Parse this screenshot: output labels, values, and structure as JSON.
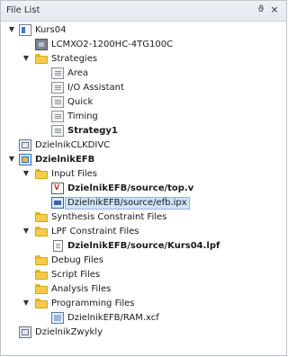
{
  "panel": {
    "title": "File List",
    "pin_glyph": "ϑ",
    "close_glyph": "×"
  },
  "tree": {
    "project": "Kurs04",
    "device": "LCMXO2-1200HC-4TG100C",
    "strategies_folder": "Strategies",
    "strategies": [
      "Area",
      "I/O Assistant",
      "Quick",
      "Timing",
      "Strategy1"
    ],
    "impl1": "DzielnikCLKDIVC",
    "impl2": "DzielnikEFB",
    "input_files_folder": "Input Files",
    "input_files": [
      "DzielnikEFB/source/top.v",
      "DzielnikEFB/source/efb.ipx"
    ],
    "synthesis_folder": "Synthesis Constraint Files",
    "lpf_folder": "LPF Constraint Files",
    "lpf_file": "DzielnikEFB/source/Kurs04.lpf",
    "debug_folder": "Debug Files",
    "script_folder": "Script Files",
    "analysis_folder": "Analysis Files",
    "programming_folder": "Programming Files",
    "programming_file": "DzielnikEFB/RAM.xcf",
    "impl3": "DzielnikZwykly"
  },
  "icons": {
    "expanded": "chevron-down",
    "folder_color": "#f4cc4a",
    "selection_color": "#cfe4f8"
  }
}
